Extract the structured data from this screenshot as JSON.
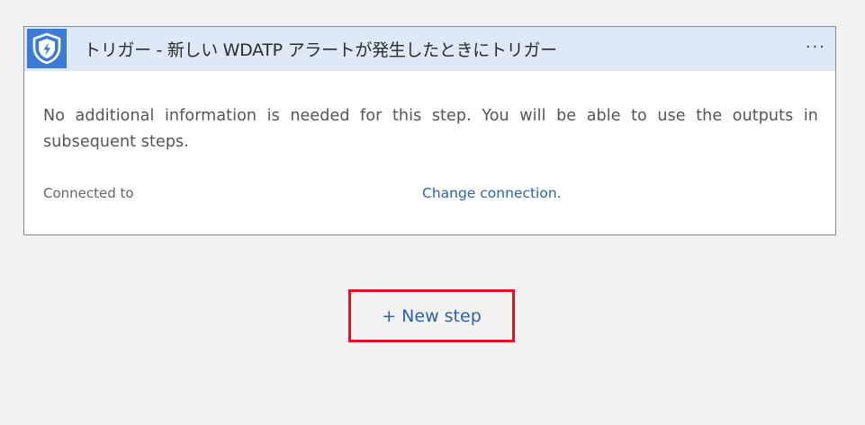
{
  "card": {
    "icon": "shield-lightning-icon",
    "title": "トリガー - 新しい WDATP アラートが発生したときにトリガー",
    "more_label": "···",
    "description": "No additional information is needed for this step. You will be able to use the outputs in subsequent steps.",
    "connected_label": "Connected to",
    "change_connection_label": "Change connection."
  },
  "new_step": {
    "label": "+ New step",
    "highlight_color": "#e0141e"
  },
  "colors": {
    "header_bg": "#dde9f6",
    "icon_bg": "#3b7bd4",
    "link": "#2f62a8"
  }
}
